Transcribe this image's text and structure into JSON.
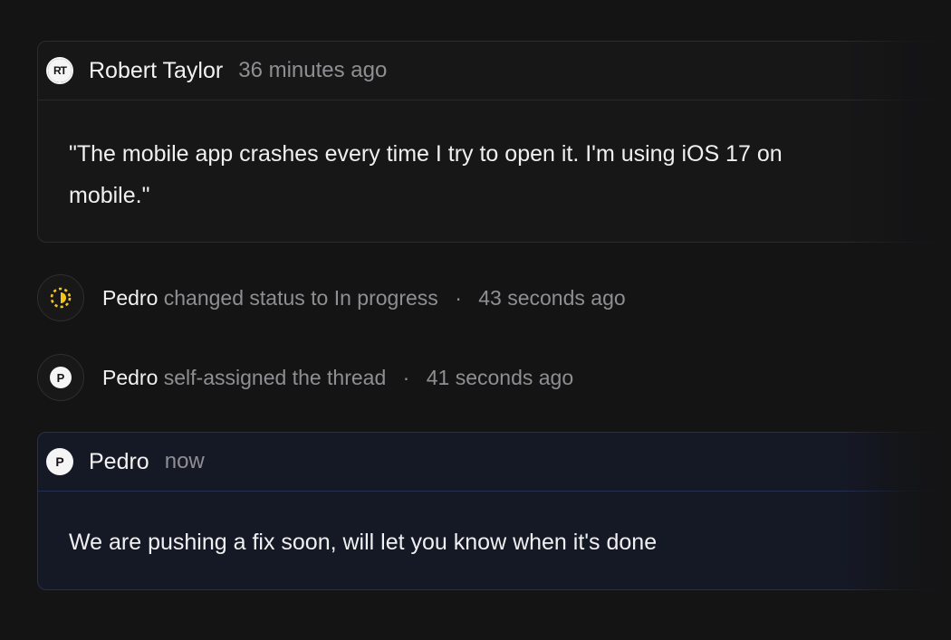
{
  "thread": {
    "customer_message": {
      "avatar_initials": "RT",
      "author": "Robert Taylor",
      "time": "36 minutes ago",
      "body_line1": "\"The mobile app crashes every time I try to open it. I'm using iOS 17 on",
      "body_line2": "mobile.\""
    },
    "events": [
      {
        "actor": "Pedro",
        "action": "changed status to In progress",
        "separator": "·",
        "time": "43 seconds ago",
        "icon": "in-progress-status-icon",
        "icon_color": "#f5c518"
      },
      {
        "avatar_initials": "P",
        "actor": "Pedro",
        "action": "self-assigned the thread",
        "separator": "·",
        "time": "41 seconds ago",
        "icon": "avatar"
      }
    ],
    "agent_reply": {
      "avatar_initials": "P",
      "author": "Pedro",
      "time": "now",
      "body": "We are pushing a fix soon, will let you know when it's done"
    }
  },
  "colors": {
    "background": "#141415",
    "reply_accent": "#253050",
    "status_in_progress": "#f5c518",
    "muted_text": "#8f8f93"
  }
}
